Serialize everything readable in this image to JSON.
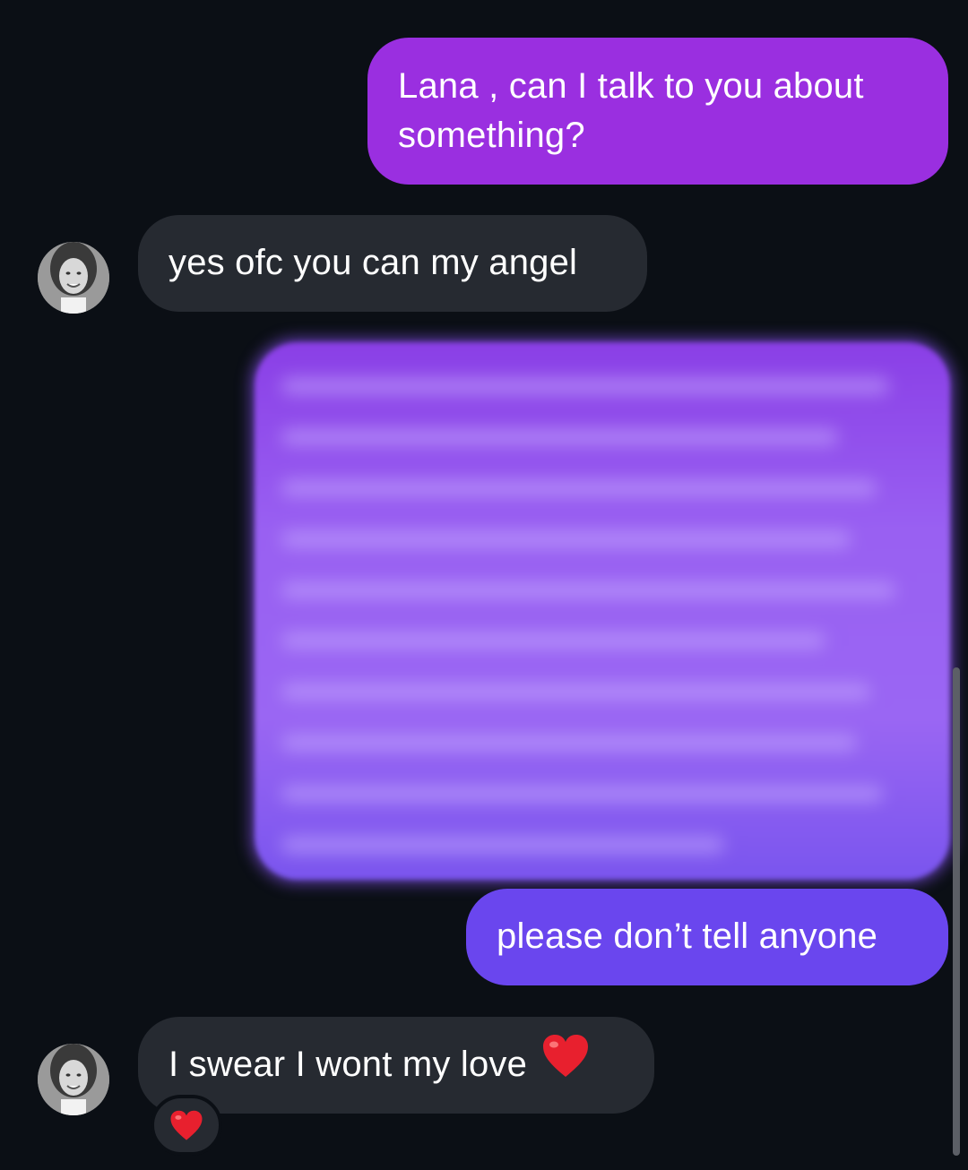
{
  "messages": {
    "sent_1": "Lana , can I talk to you about something?",
    "received_1": "yes ofc you can my angel",
    "sent_2": "please don’t tell anyone",
    "received_2": "I swear I wont my love"
  },
  "icons": {
    "avatar": "profile-photo-icon",
    "heart": "red-heart-emoji",
    "reaction": "red-heart-emoji"
  },
  "colors": {
    "background": "#0b0f15",
    "sent_bubble_top": "#9a2fe0",
    "sent_bubble_bottom": "#6a46ee",
    "received_bubble": "#262a31",
    "heart": "#e8202e"
  }
}
